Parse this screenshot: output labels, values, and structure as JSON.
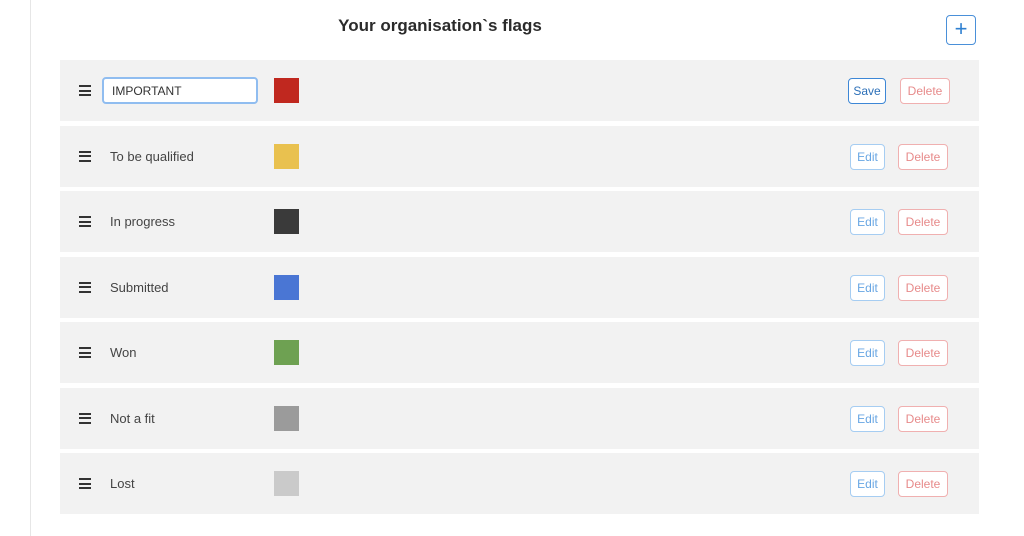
{
  "header": {
    "title": "Your organisation`s flags",
    "add_label": "+"
  },
  "flags": [
    {
      "name": "IMPORTANT",
      "color": "#c0281f",
      "mode": "editing",
      "primary_label": "Save",
      "delete_label": "Delete"
    },
    {
      "name": "To be qualified",
      "color": "#e9c14f",
      "mode": "view",
      "primary_label": "Edit",
      "delete_label": "Delete"
    },
    {
      "name": "In progress",
      "color": "#3a3a3a",
      "mode": "view",
      "primary_label": "Edit",
      "delete_label": "Delete"
    },
    {
      "name": "Submitted",
      "color": "#4a76d4",
      "mode": "view",
      "primary_label": "Edit",
      "delete_label": "Delete"
    },
    {
      "name": "Won",
      "color": "#6ea152",
      "mode": "view",
      "primary_label": "Edit",
      "delete_label": "Delete"
    },
    {
      "name": "Not a fit",
      "color": "#9b9b9b",
      "mode": "view",
      "primary_label": "Edit",
      "delete_label": "Delete"
    },
    {
      "name": "Lost",
      "color": "#cacaca",
      "mode": "view",
      "primary_label": "Edit",
      "delete_label": "Delete"
    }
  ]
}
